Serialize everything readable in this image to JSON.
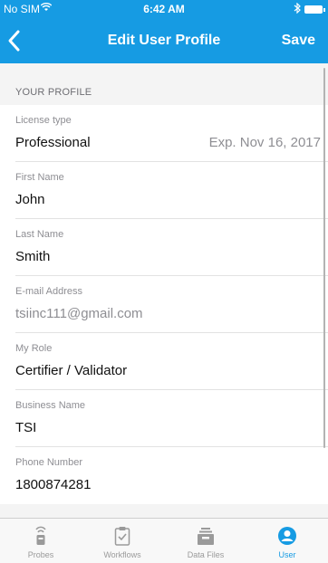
{
  "status_bar": {
    "carrier": "No SIM",
    "time": "6:42 AM"
  },
  "nav": {
    "title": "Edit User Profile",
    "save_label": "Save"
  },
  "profile": {
    "section_title": "YOUR PROFILE",
    "fields": [
      {
        "label": "License type",
        "value": "Professional",
        "extra": "Exp. Nov 16, 2017"
      },
      {
        "label": "First Name",
        "value": "John"
      },
      {
        "label": "Last Name",
        "value": "Smith"
      },
      {
        "label": "E-mail Address",
        "value": "tsiinc111@gmail.com"
      },
      {
        "label": "My Role",
        "value": "Certifier / Validator"
      },
      {
        "label": "Business Name",
        "value": "TSI"
      },
      {
        "label": "Phone Number",
        "value": "1800874281"
      }
    ]
  },
  "tabs": [
    {
      "label": "Probes",
      "icon": "probe-icon"
    },
    {
      "label": "Workflows",
      "icon": "clipboard-check-icon"
    },
    {
      "label": "Data Files",
      "icon": "data-files-icon"
    },
    {
      "label": "User",
      "icon": "user-icon",
      "active": true
    }
  ],
  "colors": {
    "accent": "#169be3",
    "inactive": "#9a9a9a"
  }
}
